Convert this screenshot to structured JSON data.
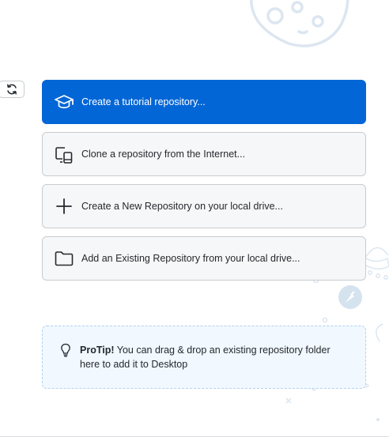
{
  "actions": [
    {
      "label": "Create a tutorial repository...",
      "icon": "mortarboard-icon",
      "primary": true
    },
    {
      "label": "Clone a repository from the Internet...",
      "icon": "device-desktop-icon",
      "primary": false
    },
    {
      "label": "Create a New Repository on your local drive...",
      "icon": "plus-icon",
      "primary": false
    },
    {
      "label": "Add an Existing Repository from your local drive...",
      "icon": "folder-icon",
      "primary": false
    }
  ],
  "protip": {
    "title": "ProTip!",
    "message": "You can drag & drop an existing repository folder here to add it to Desktop",
    "icon": "lightbulb-icon"
  },
  "refresh": {
    "icon": "refresh-icon"
  },
  "colors": {
    "primary": "#0366d6",
    "button_bg": "#f6f7f8",
    "border": "#c8ccd0",
    "protip_bg": "#f1f8ff",
    "protip_border": "#b4d2f0",
    "decoration": "#dce6f0"
  }
}
